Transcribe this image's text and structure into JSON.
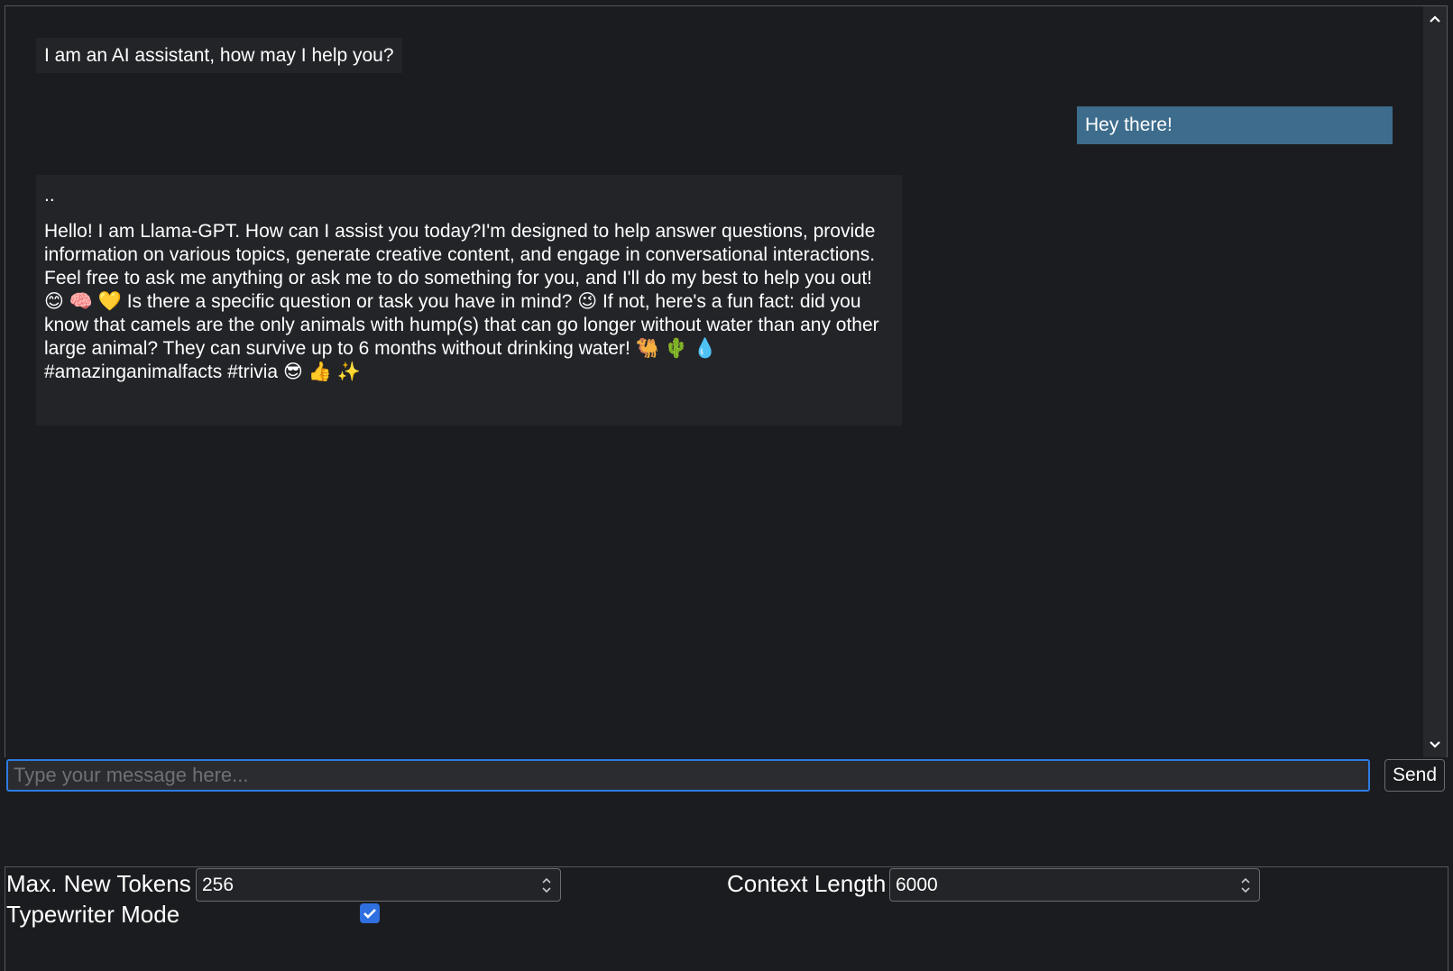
{
  "chat": {
    "messages": [
      {
        "role": "assistant",
        "text": "I am an AI assistant, how may I help you?"
      },
      {
        "role": "user",
        "text": "Hey there!"
      },
      {
        "role": "assistant",
        "prefix": "..",
        "text": "Hello! I am Llama-GPT. How can I assist you today?I'm designed to help answer questions, provide information on various topics, generate creative content, and engage in conversational interactions. Feel free to ask me anything or ask me to do something for you, and I'll do my best to help you out! 😊 🧠 💛 Is there a specific question or task you have in mind? 😉 If not, here's a fun fact: did you know that camels are the only animals with hump(s) that can go longer without water than any other large animal? They can survive up to 6 months without drinking water! 🐫 🌵 💧 #amazinganimalfacts #trivia 😎 👍 ✨"
      }
    ]
  },
  "composer": {
    "placeholder": "Type your message here...",
    "value": "",
    "send_label": "Send"
  },
  "settings": {
    "max_tokens_label": "Max. New Tokens",
    "max_tokens_value": "256",
    "context_length_label": "Context Length",
    "context_length_value": "6000",
    "typewriter_label": "Typewriter Mode",
    "typewriter_checked": true
  },
  "colors": {
    "background": "#1b1c1f",
    "assistant_bubble": "#222428",
    "user_bubble": "#3d6c8c",
    "accent": "#2d7be3"
  }
}
